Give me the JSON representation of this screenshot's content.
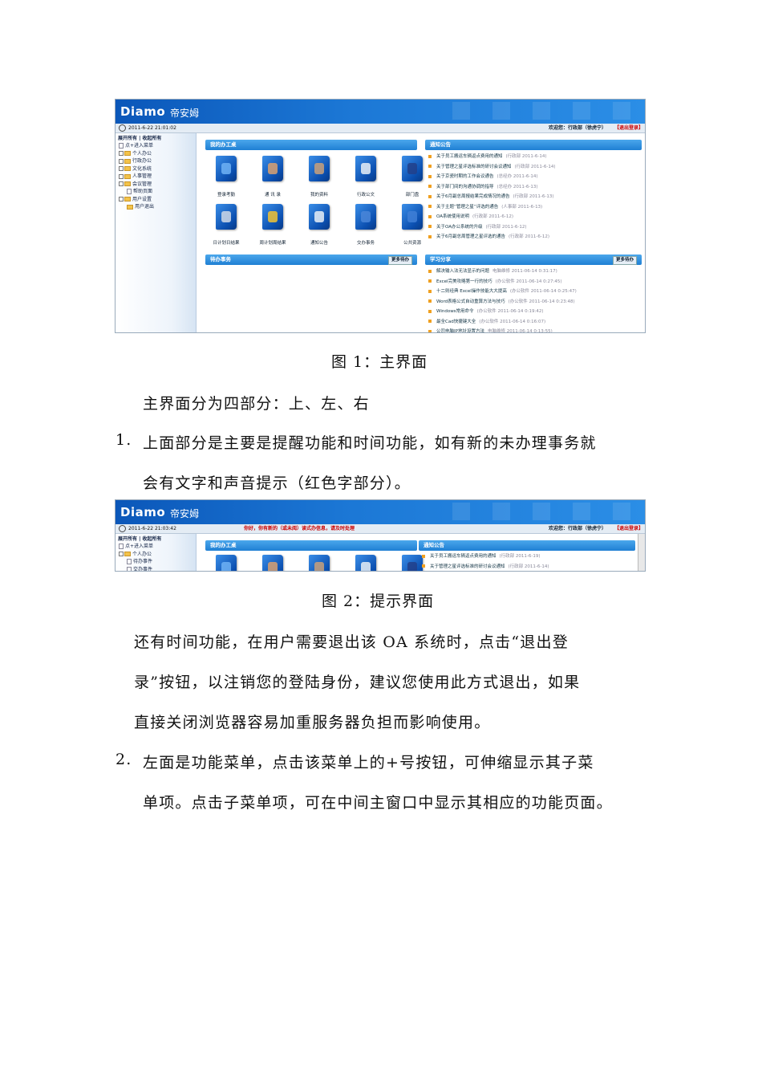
{
  "app": {
    "logo_text": "Diamo",
    "logo_cn": "帝安姆",
    "welcome": "欢迎您：行政部（徐虎宁）",
    "logout": "【退出登录】",
    "sidebar_header": "展开所有 | 收起所有"
  },
  "screenshot1": {
    "time": "2011-6-22 21:01:02",
    "sidebar": [
      {
        "label": "点+进入菜单",
        "kind": "tip",
        "depth": 0
      },
      {
        "label": "个人办公",
        "kind": "folder",
        "depth": 0
      },
      {
        "label": "行政办公",
        "kind": "folder",
        "depth": 0
      },
      {
        "label": "文化系统",
        "kind": "folder",
        "depth": 0
      },
      {
        "label": "人事管理",
        "kind": "folder",
        "depth": 0
      },
      {
        "label": "会议管理",
        "kind": "folder",
        "depth": 0
      },
      {
        "label": "帮助页面",
        "kind": "doc",
        "depth": 1
      },
      {
        "label": "用户设置",
        "kind": "folder",
        "depth": 0
      },
      {
        "label": "用户退出",
        "kind": "exit",
        "depth": 1
      }
    ],
    "my_tools_title": "我的办工桌",
    "tools": [
      {
        "label": "登录考勤"
      },
      {
        "label": "通 讯 录"
      },
      {
        "label": "我的资料"
      },
      {
        "label": "行政公文"
      },
      {
        "label": "部门盘"
      },
      {
        "label": "日计划日结果"
      },
      {
        "label": "周计划周结果"
      },
      {
        "label": "通知公告"
      },
      {
        "label": "交办事务"
      },
      {
        "label": "公共资源"
      }
    ],
    "todo_title": "待办事务",
    "todo_more": "更多待办",
    "notice_title": "通知公告",
    "notices": [
      {
        "text": "关于员工搬运车辆返点费用的通知",
        "meta": "(行政部 2011-6-14)"
      },
      {
        "text": "关于管理之星评选标准的研讨会议通知",
        "meta": "(行政部 2011-6-14)"
      },
      {
        "text": "关于京瓷时期的工作会议通告",
        "meta": "(总经办 2011-6-14)"
      },
      {
        "text": "关于部门间的沟通协调的指导",
        "meta": "(总经办 2011-6-13)"
      },
      {
        "text": "关于6月副总周报结果完成情况的通告",
        "meta": "(行政部 2011-6-13)"
      },
      {
        "text": "关于主题“管理之星”评选的通告",
        "meta": "(人事部 2011-6-13)"
      },
      {
        "text": "OA系统使用说明",
        "meta": "(行政部 2011-6-12)"
      },
      {
        "text": "关于OA办公系统的升级",
        "meta": "(行政部 2011-6-12)"
      },
      {
        "text": "关于6月副总周管理之星评选的通告",
        "meta": "(行政部 2011-6-12)"
      }
    ],
    "study_title": "学习分享",
    "study_more": "更多待办",
    "studies": [
      {
        "text": "解决输入法无法显示的问题",
        "meta": "电脑维修  2011-06-14 0:31:17)"
      },
      {
        "text": "Excel完美攻略第一行的技巧",
        "meta": "(办公软件  2011-06-14 0:27:45)"
      },
      {
        "text": "十二则经典 Excel操作技能大大提高",
        "meta": "(办公软件  2011-06-14 0:25:47)"
      },
      {
        "text": "Word表格公式自动重算方法与技巧",
        "meta": "(办公软件  2011-06-14 0:23:48)"
      },
      {
        "text": "Windows常用命令",
        "meta": "(办公软件  2011-06-14 0:19:42)"
      },
      {
        "text": "最全Cad快捷键大全",
        "meta": "(办公软件  2011-06-14 0:16:07)"
      },
      {
        "text": "公司电脑IP地址设置方法",
        "meta": "电脑维修  2011-06-14 0:13:55)"
      }
    ]
  },
  "caption1": "图 1：主界面",
  "intro": "主界面分为四部分：上、左、右",
  "item1": {
    "num": "1.",
    "line1": "上面部分是主要是提醒功能和时间功能，如有新的未办理事务就",
    "line2": "会有文字和声音提示（红色字部分）。"
  },
  "screenshot2": {
    "time": "2011-6-22 21:03:42",
    "alert": "你好，你有新的（或未阅）读式办信息，请及时处理",
    "sidebar": [
      {
        "label": "点+进入菜单",
        "kind": "tip",
        "depth": 0
      },
      {
        "label": "个人办公",
        "kind": "folder",
        "depth": 0
      },
      {
        "label": "待办事件",
        "kind": "doc",
        "depth": 1
      },
      {
        "label": "交办事件",
        "kind": "doc",
        "depth": 1
      }
    ],
    "my_tools_title": "我的办工桌",
    "notice_title": "通知公告",
    "notices": [
      {
        "text": "关于员工搬运车辆返点费用的通知",
        "meta": "(行政部 2011-6-19)"
      },
      {
        "text": "关于管理之星评选标准的研讨会议通知",
        "meta": "(行政部 2011-6-14)"
      }
    ]
  },
  "caption2": "图 2：提示界面",
  "para": {
    "line1": "还有时间功能，在用户需要退出该 OA 系统时，点击“退出登",
    "line2": "录”按钮，以注销您的登陆身份，建议您使用此方式退出，如果",
    "line3": "直接关闭浏览器容易加重服务器负担而影响使用。"
  },
  "item2": {
    "num": "2.",
    "line1": "左面是功能菜单，点击该菜单上的+号按钮，可伸缩显示其子菜",
    "line2": "单项。点击子菜单项，可在中间主窗口中显示其相应的功能页面。"
  }
}
